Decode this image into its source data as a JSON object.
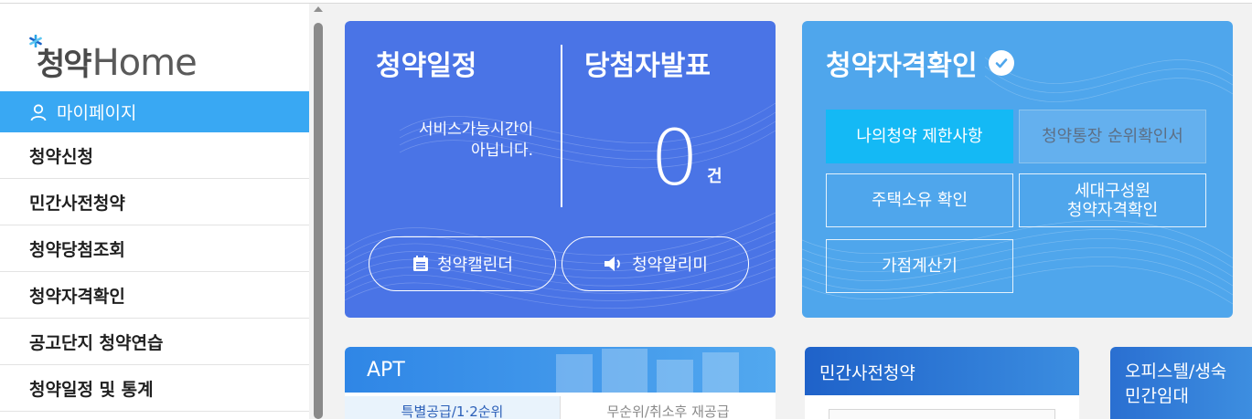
{
  "sidebar": {
    "logo_kor": "청약",
    "logo_eng": "Home",
    "mypage_label": "마이페이지",
    "menu": [
      {
        "label": "청약신청"
      },
      {
        "label": "민간사전청약"
      },
      {
        "label": "청약당첨조회"
      },
      {
        "label": "청약자격확인"
      },
      {
        "label": "공고단지 청약연습"
      },
      {
        "label": "청약일정 및 통계"
      }
    ]
  },
  "schedule_card": {
    "title_left": "청약일정",
    "title_right": "당첨자발표",
    "service_line1": "서비스가능시간이",
    "service_line2": "아닙니다.",
    "count": "0",
    "count_unit": "건",
    "calendar_button": "청약캘린더",
    "alarm_button": "청약알리미"
  },
  "eligibility_card": {
    "title": "청약자격확인",
    "buttons": {
      "limit": "나의청약 제한사항",
      "rank": "청약통장 순위확인서",
      "house": "주택소유 확인",
      "household_line1": "세대구성원",
      "household_line2": "청약자격확인",
      "points": "가점계산기"
    }
  },
  "apt_panel": {
    "title": "APT",
    "tab1": "특별공급/1·2순위",
    "tab2": "무순위/취소후 재공급"
  },
  "private_panel": {
    "title": "민간사전청약"
  },
  "officetel_panel": {
    "title_line1": "오피스텔/생숙",
    "title_line2": "민간임대"
  },
  "colors": {
    "sidebar_active": "#39a8f3",
    "schedule_card_bg": "#4a74e6",
    "eligibility_card_bg": "#4fa6ec",
    "active_button": "#14b9f5"
  }
}
